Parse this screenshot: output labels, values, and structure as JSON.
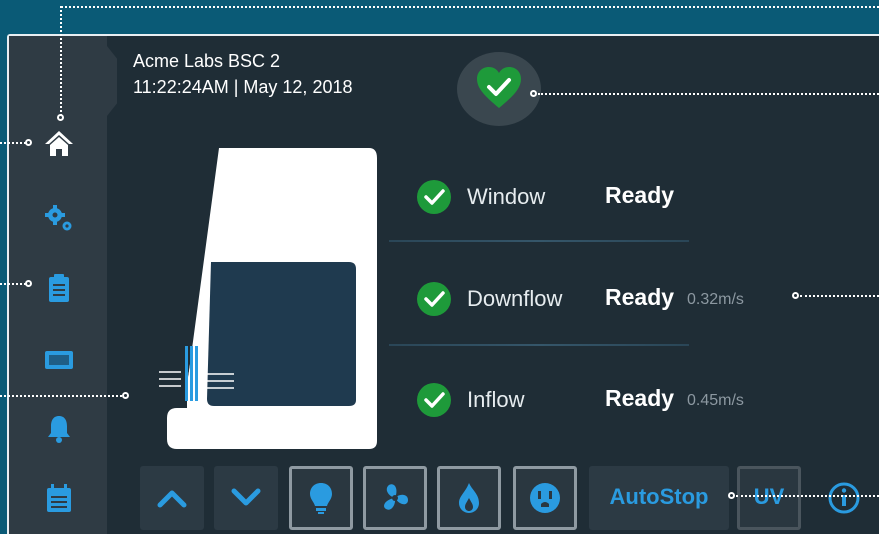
{
  "header": {
    "device_name": "Acme Labs BSC 2",
    "datetime": "11:22:24AM | May 12, 2018"
  },
  "status": {
    "overall": "heart-check-icon",
    "rows": [
      {
        "label": "Window",
        "value": "Ready",
        "extra": ""
      },
      {
        "label": "Downflow",
        "value": "Ready",
        "extra": "0.32m/s"
      },
      {
        "label": "Inflow",
        "value": "Ready",
        "extra": "0.45m/s"
      }
    ]
  },
  "sidebar": {
    "items": [
      {
        "icon": "home-icon"
      },
      {
        "icon": "gear-icon"
      },
      {
        "icon": "clipboard-icon"
      },
      {
        "icon": "display-icon"
      },
      {
        "icon": "bell-icon"
      },
      {
        "icon": "calendar-icon"
      }
    ]
  },
  "toolbar": {
    "autostop_label": "AutoStop",
    "uv_label": "UV"
  },
  "colors": {
    "accent": "#2a9be0",
    "ok_green": "#1e9a3a",
    "background": "#1f2d36",
    "frame": "#0a5a76"
  }
}
